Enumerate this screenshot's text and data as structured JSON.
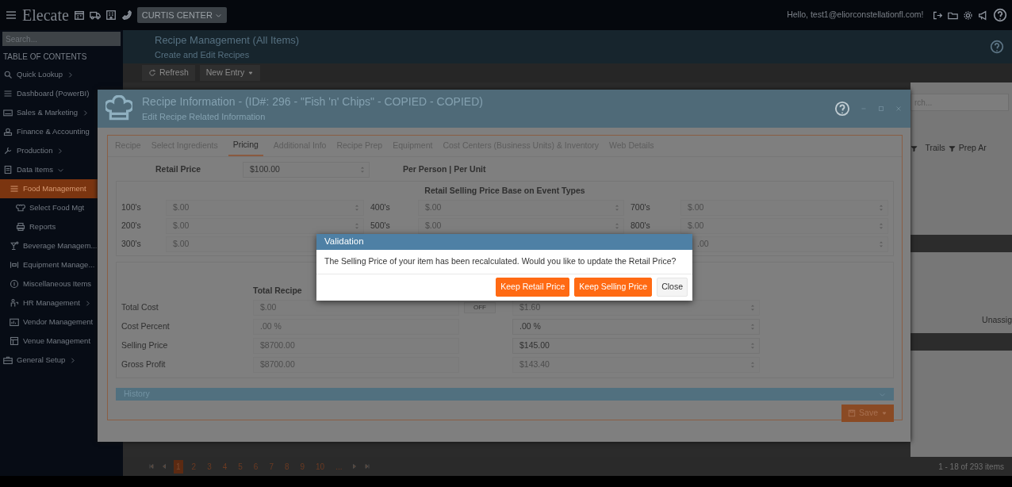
{
  "topbar": {
    "logo": "Elecate",
    "location": "CURTIS CENTER",
    "greeting": "Hello, test1@eliorconstellationfl.com!"
  },
  "sidebar": {
    "search_placeholder": "Search...",
    "heading": "TABLE OF CONTENTS",
    "items": [
      {
        "label": "Quick Lookup",
        "selected": false,
        "expanded": false
      },
      {
        "label": "Dashboard (PowerBI)",
        "selected": false
      },
      {
        "label": "Sales & Marketing",
        "selected": false,
        "expanded": false
      },
      {
        "label": "Finance & Accounting",
        "selected": false
      },
      {
        "label": "Production",
        "selected": false,
        "expanded": false
      },
      {
        "label": "Data Items",
        "selected": false,
        "expanded": true,
        "children": [
          {
            "label": "Food Management",
            "selected": true,
            "children": [
              {
                "label": "Select Food Mgt",
                "selected": false
              },
              {
                "label": "Reports",
                "selected": false
              }
            ]
          },
          {
            "label": "Beverage Managem...",
            "selected": false
          },
          {
            "label": "Equipment Manage...",
            "selected": false
          },
          {
            "label": "Miscellaneous Items",
            "selected": false
          },
          {
            "label": "HR Management",
            "selected": false,
            "expanded": false
          },
          {
            "label": "Vendor Management",
            "selected": false
          },
          {
            "label": "Venue Management",
            "selected": false
          }
        ]
      },
      {
        "label": "General Setup",
        "selected": false,
        "expanded": false
      }
    ]
  },
  "page": {
    "title": "Recipe Management (All Items)",
    "subtitle": "Create and Edit Recipes",
    "toolbar": [
      {
        "label": "Refresh",
        "kind": "refresh"
      },
      {
        "label": "New Entry",
        "kind": "dropdown"
      }
    ],
    "grid": {
      "search_placeholder": "rch...",
      "columns": [
        "Trails",
        "Prep Ar"
      ],
      "cell": "Unassig"
    },
    "pager": {
      "pages": [
        {
          "label": "1",
          "selected": true
        },
        {
          "label": "2",
          "selected": false
        },
        {
          "label": "3",
          "selected": false
        },
        {
          "label": "4",
          "selected": false
        },
        {
          "label": "5",
          "selected": false
        },
        {
          "label": "6",
          "selected": false
        },
        {
          "label": "7",
          "selected": false
        },
        {
          "label": "8",
          "selected": false
        },
        {
          "label": "9",
          "selected": false
        },
        {
          "label": "10",
          "selected": false
        },
        {
          "label": "...",
          "selected": false
        }
      ],
      "summary": "1 - 18 of 293 items"
    }
  },
  "modal": {
    "title": "Recipe Information - (ID#: 296 - \"Fish 'n' Chips\" - COPIED - COPIED)",
    "subtitle": "Edit Recipe Related Information",
    "tabs": [
      {
        "label": "Recipe",
        "selected": false
      },
      {
        "label": "Select Ingredients",
        "selected": false
      },
      {
        "label": "Pricing",
        "selected": true
      },
      {
        "label": "Additional Info",
        "selected": false
      },
      {
        "label": "Recipe Prep",
        "selected": false
      },
      {
        "label": "Equipment",
        "selected": false
      },
      {
        "label": "Cost Centers (Business Units) & Inventory",
        "selected": false
      },
      {
        "label": "Web Details",
        "selected": false
      }
    ],
    "retail_price": {
      "label": "Retail Price",
      "value": "$100.00",
      "unit": "Per Person | Per Unit"
    },
    "event_prices": {
      "title": "Retail Selling Price Base on Event Types",
      "columns": [
        [
          {
            "label": "100's",
            "value": "$.00"
          },
          {
            "label": "200's",
            "value": "$.00"
          },
          {
            "label": "300's",
            "value": "$.00"
          }
        ],
        [
          {
            "label": "400's",
            "value": "$.00"
          },
          {
            "label": "500's",
            "value": "$.00"
          }
        ],
        [
          {
            "label": "700's",
            "value": "$.00"
          },
          {
            "label": "800's",
            "value": "$.00"
          },
          {
            "value": ".00"
          }
        ]
      ]
    },
    "totals": {
      "column_header": "Total Recipe",
      "rows": [
        {
          "label": "Total Cost",
          "recipe": "$.00",
          "toggle": {
            "label": "OFF",
            "on": false
          },
          "value": "$1.60",
          "disabled": true
        },
        {
          "label": "Cost Percent",
          "recipe": ".00 %",
          "value": ".00 %",
          "disabled": false
        },
        {
          "label": "Selling Price",
          "recipe": "$8700.00",
          "value": "$145.00",
          "disabled": false
        },
        {
          "label": "Gross Profit",
          "recipe": "$8700.00",
          "value": "$143.40",
          "disabled": true
        }
      ]
    },
    "history": "History",
    "save": "Save"
  },
  "dialog": {
    "title": "Validation",
    "message": "The Selling Price of your item has been recalculated. Would you like to update the Retail Price?",
    "buttons": [
      {
        "label": "Keep Retail Price",
        "kind": "primary"
      },
      {
        "label": "Keep Selling Price",
        "kind": "primary"
      },
      {
        "label": "Close",
        "kind": "secondary"
      }
    ]
  }
}
